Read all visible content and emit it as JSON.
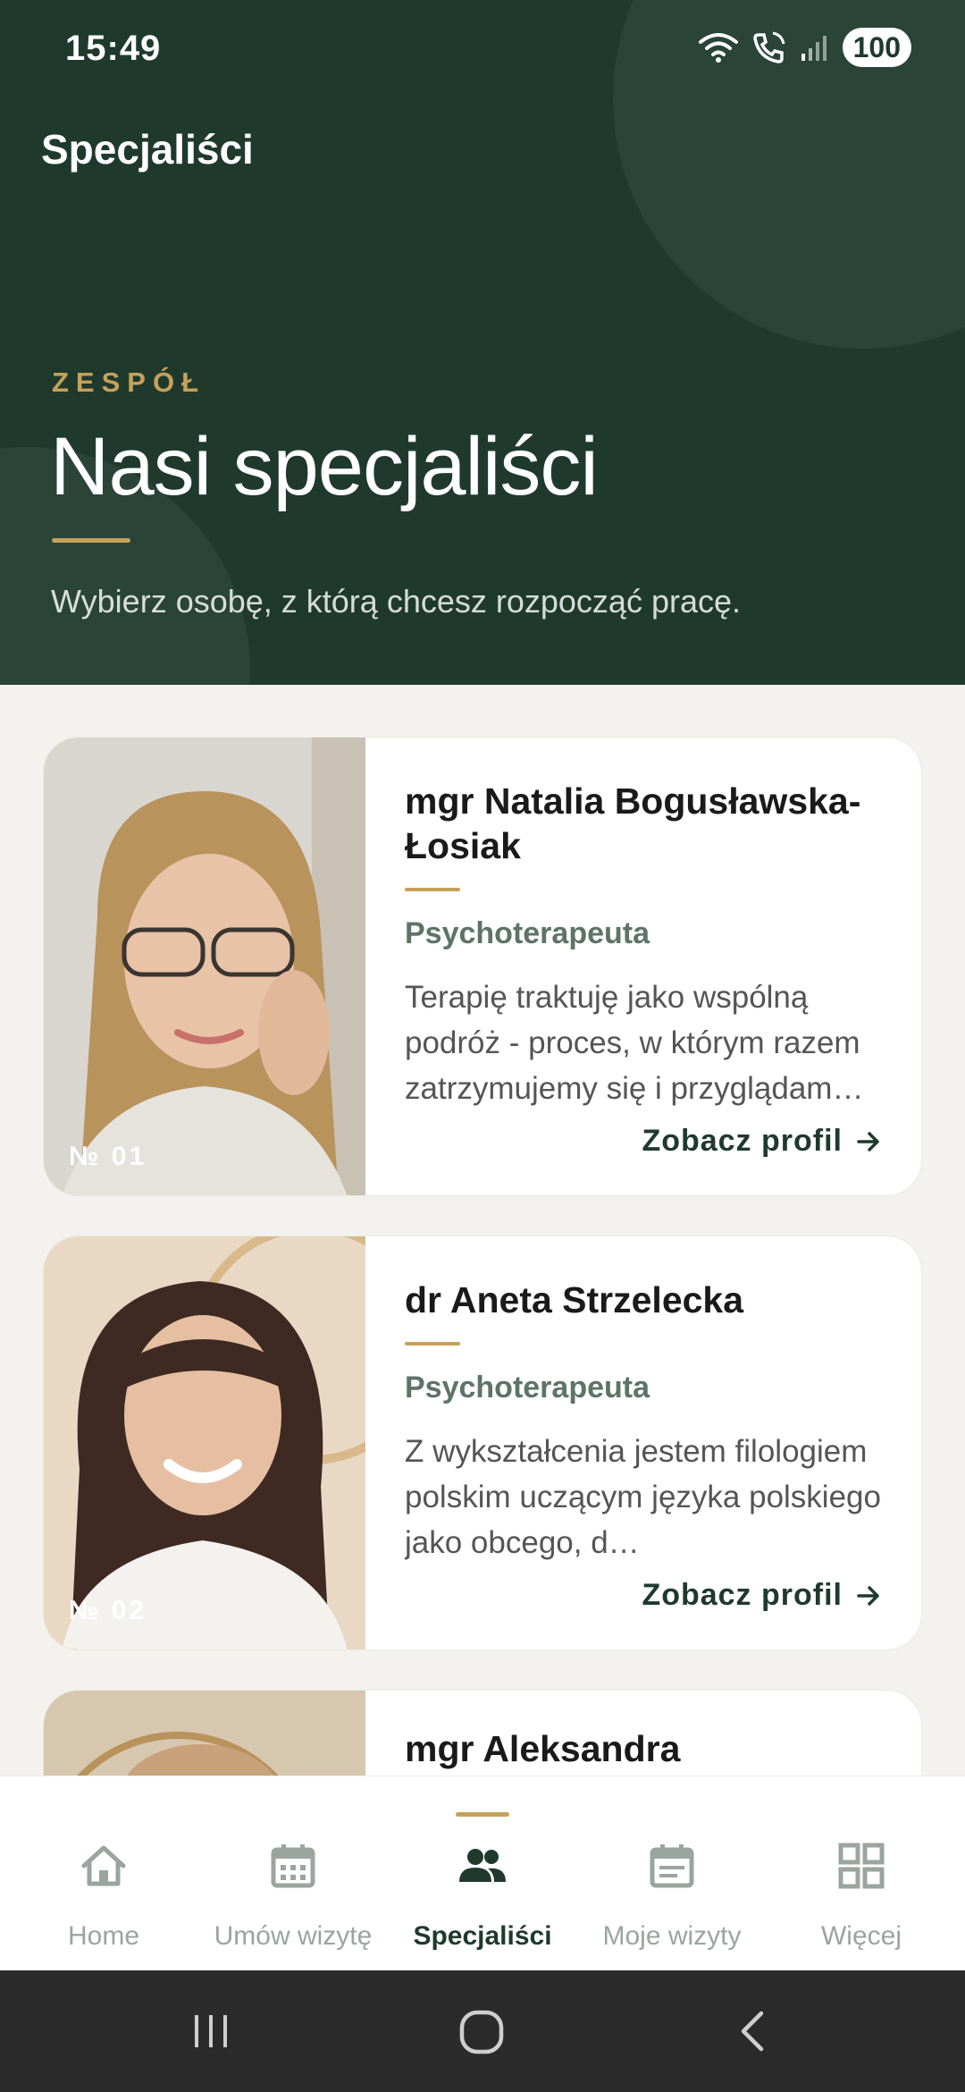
{
  "status_bar": {
    "time": "15:49",
    "battery": "100"
  },
  "appbar": {
    "title": "Specjaliści"
  },
  "hero": {
    "eyebrow": "ZESPÓŁ",
    "title": "Nasi specjaliści",
    "subtitle": "Wybierz osobę, z którą chcesz rozpocząć pracę."
  },
  "specialists": [
    {
      "number": "№ 01",
      "name": "mgr Natalia Bogusławska-Łosiak",
      "role": "Psychoterapeuta",
      "description": "Terapię traktuję jako wspólną podróż - proces, w którym razem zatrzymujemy się i przyglądam…",
      "cta": "Zobacz profil"
    },
    {
      "number": "№ 02",
      "name": "dr Aneta Strzelecka",
      "role": "Psychoterapeuta",
      "description": "Z wykształcenia jestem filologiem polskim uczącym języka polskiego jako obcego, d…",
      "cta": "Zobacz profil"
    },
    {
      "name": "mgr Aleksandra Kałużyńska"
    }
  ],
  "bottom_nav": {
    "items": [
      {
        "label": "Home",
        "icon": "home-icon"
      },
      {
        "label": "Umów wizytę",
        "icon": "calendar-grid-icon"
      },
      {
        "label": "Specjaliści",
        "icon": "people-icon",
        "active": true
      },
      {
        "label": "Moje wizyty",
        "icon": "calendar-list-icon"
      },
      {
        "label": "Więcej",
        "icon": "grid-icon"
      }
    ]
  },
  "colors": {
    "header_bg": "#1f3a2d",
    "accent_gold": "#c7a15a",
    "role_green": "#5d7466",
    "page_bg": "#f4f2ee"
  }
}
